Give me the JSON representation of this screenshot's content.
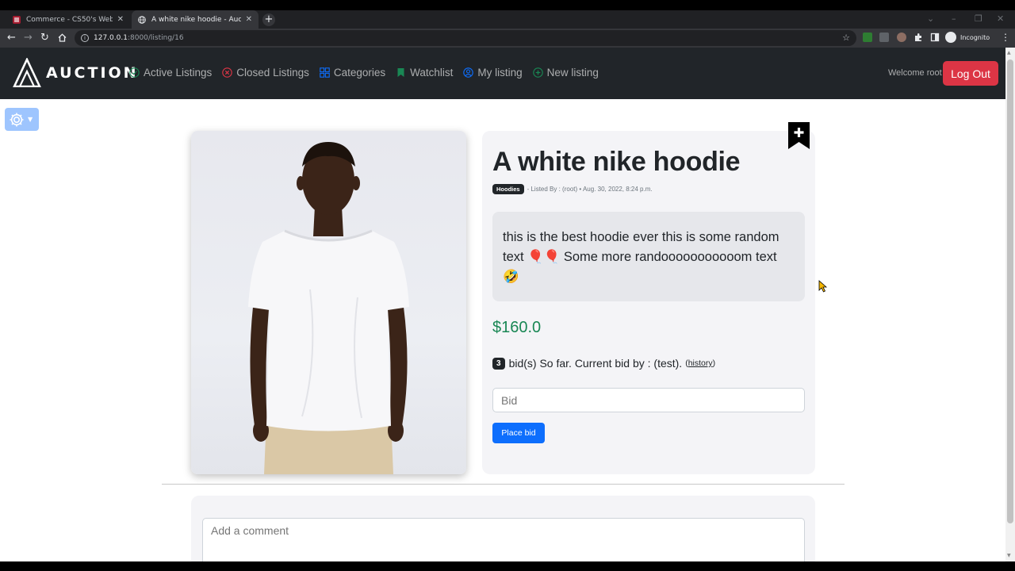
{
  "browser": {
    "tabs": [
      {
        "title": "Commerce - CS50's Web Programming",
        "active": false
      },
      {
        "title": "A white nike hoodie - Auction",
        "active": true
      }
    ],
    "url_host": "127.0.0.1",
    "url_path": ":8000/listing/16",
    "profile_label": "Incognito"
  },
  "site": {
    "brand": "AUCTION",
    "nav": [
      {
        "label": "Active Listings",
        "icon": "check-circle-icon",
        "color": "#198754"
      },
      {
        "label": "Closed Listings",
        "icon": "x-circle-icon",
        "color": "#dc3545"
      },
      {
        "label": "Categories",
        "icon": "grid-icon",
        "color": "#0d6efd"
      },
      {
        "label": "Watchlist",
        "icon": "bookmark-icon",
        "color": "#198754"
      },
      {
        "label": "My listing",
        "icon": "person-circle-icon",
        "color": "#0d6efd"
      },
      {
        "label": "New listing",
        "icon": "plus-circle-icon",
        "color": "#198754"
      }
    ],
    "welcome": "Welcome root",
    "logout": "Log Out"
  },
  "listing": {
    "title": "A white nike hoodie",
    "category": "Hoodies",
    "meta": "- Listed By : (root) • Aug. 30, 2022, 8:24 p.m.",
    "description": "this is the best hoodie ever this is some random text 🎈🎈 Some more randooooooooooom text 🤣",
    "price": "$160.0",
    "bid_count": "3",
    "bid_text": "bid(s) So far. Current bid by : (test).",
    "history_label": "history",
    "bid_placeholder": "Bid",
    "place_bid": "Place bid",
    "comment_placeholder": "Add a comment"
  },
  "colors": {
    "navbar": "#212529",
    "price": "#198754",
    "primary": "#0d6efd",
    "danger": "#dc3545"
  }
}
